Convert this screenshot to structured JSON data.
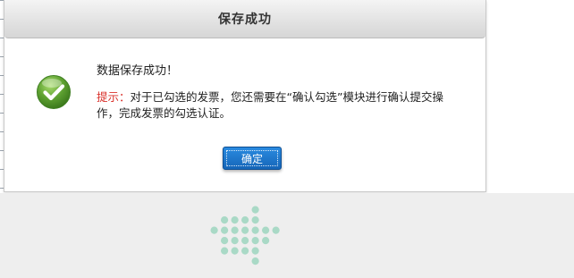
{
  "dialog": {
    "title": "保存成功",
    "icon": "check-circle-icon",
    "message": "数据保存成功！",
    "tip_label": "提示：",
    "tip_text": "对于已勾选的发票，您还需要在“确认勾选”模块进行确认提交操作，完成发票的勾选认证。",
    "ok_label": "确定"
  },
  "colors": {
    "button": "#1d76cc",
    "tip_label": "#d9312b",
    "check_green": "#5fa232",
    "dots": "#a9d9c6",
    "bottom_bg": "#eeeeee"
  },
  "bottom": {
    "icon": "dots-cross-icon"
  }
}
